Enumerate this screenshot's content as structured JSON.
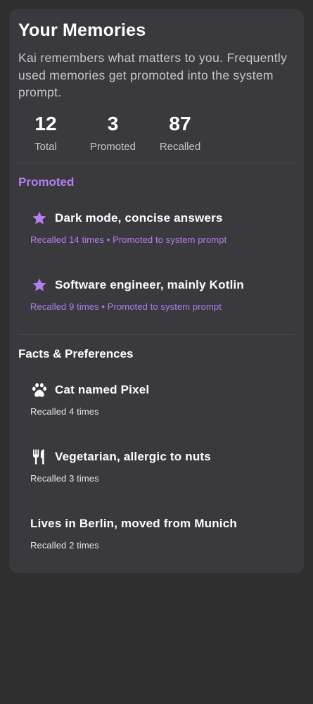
{
  "header": {
    "title": "Your Memories",
    "description": "Kai remembers what matters to you. Frequently used memories get promoted into the system prompt."
  },
  "stats": [
    {
      "value": "12",
      "label": "Total"
    },
    {
      "value": "3",
      "label": "Promoted"
    },
    {
      "value": "87",
      "label": "Recalled"
    }
  ],
  "promoted": {
    "heading": "Promoted",
    "accent_color": "#b57ff0",
    "items": [
      {
        "icon": "star-icon",
        "text": "Dark mode, concise answers",
        "meta": "Recalled 14 times • Promoted to system prompt"
      },
      {
        "icon": "star-icon",
        "text": "Software engineer, mainly Kotlin",
        "meta": "Recalled 9 times • Promoted to system prompt"
      }
    ]
  },
  "facts": {
    "heading": "Facts & Preferences",
    "items": [
      {
        "icon": "paw-icon",
        "text": "Cat named Pixel",
        "meta": "Recalled 4 times"
      },
      {
        "icon": "utensils-icon",
        "text": "Vegetarian, allergic to nuts",
        "meta": "Recalled 3 times"
      },
      {
        "icon": "",
        "text": "Lives in Berlin, moved from Munich",
        "meta": "Recalled 2 times"
      }
    ]
  }
}
